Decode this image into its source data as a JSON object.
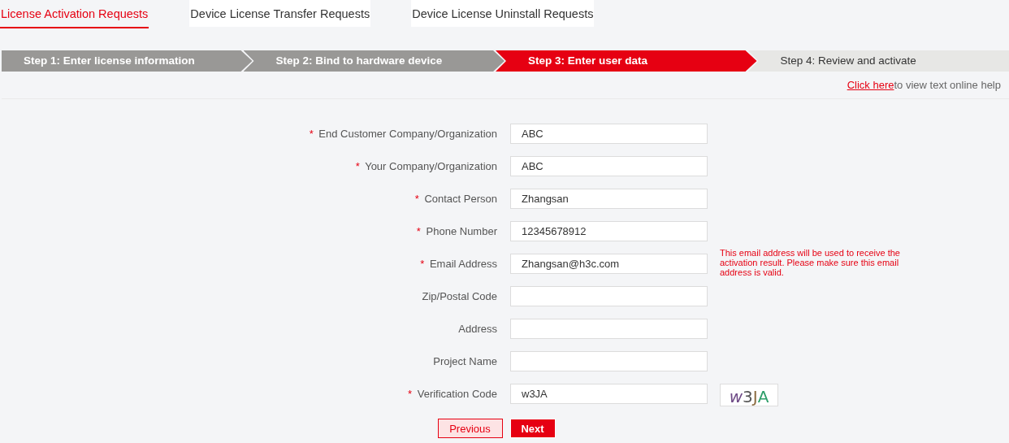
{
  "tabs": [
    {
      "label": "License Activation Requests",
      "selected": true
    },
    {
      "label": "Device License Transfer Requests",
      "selected": false
    },
    {
      "label": "Device License Uninstall Requests",
      "selected": false
    }
  ],
  "steps": [
    {
      "label": "Step 1: Enter license information",
      "kind": "done"
    },
    {
      "label": "Step 2: Bind to hardware device",
      "kind": "done"
    },
    {
      "label": "Step 3: Enter user data",
      "kind": "current"
    },
    {
      "label": "Step 4: Review and activate",
      "kind": "todo"
    }
  ],
  "help": {
    "link": "Click here",
    "text": "to view text online help"
  },
  "fields": [
    {
      "label": "End Customer Company/Organization",
      "marker": "*",
      "value": "ABC"
    },
    {
      "label": "Your Company/Organization",
      "marker": "*",
      "value": "ABC"
    },
    {
      "label": "Contact Person",
      "marker": "*",
      "value": "Zhangsan"
    },
    {
      "label": "Phone Number",
      "marker": "*",
      "value": "12345678912"
    },
    {
      "label": "Email Address",
      "marker": "*",
      "value": "Zhangsan@h3c.com",
      "note": "This email address will be used to receive the activation result. Please make sure this email address is valid."
    },
    {
      "label": "Zip/Postal Code"
    },
    {
      "label": "Address"
    },
    {
      "label": "Project Name"
    },
    {
      "label": "Verification Code",
      "marker": "*",
      "value": "w3JA",
      "captcha": [
        {
          "char": "w",
          "color": "#6e4a86"
        },
        {
          "char": "3",
          "color": "#555555"
        },
        {
          "char": "J",
          "color": "#8a6a3e"
        },
        {
          "char": "A",
          "color": "#2f9e6a"
        }
      ]
    }
  ],
  "buttons": {
    "previous": "Previous",
    "next": "Next"
  }
}
